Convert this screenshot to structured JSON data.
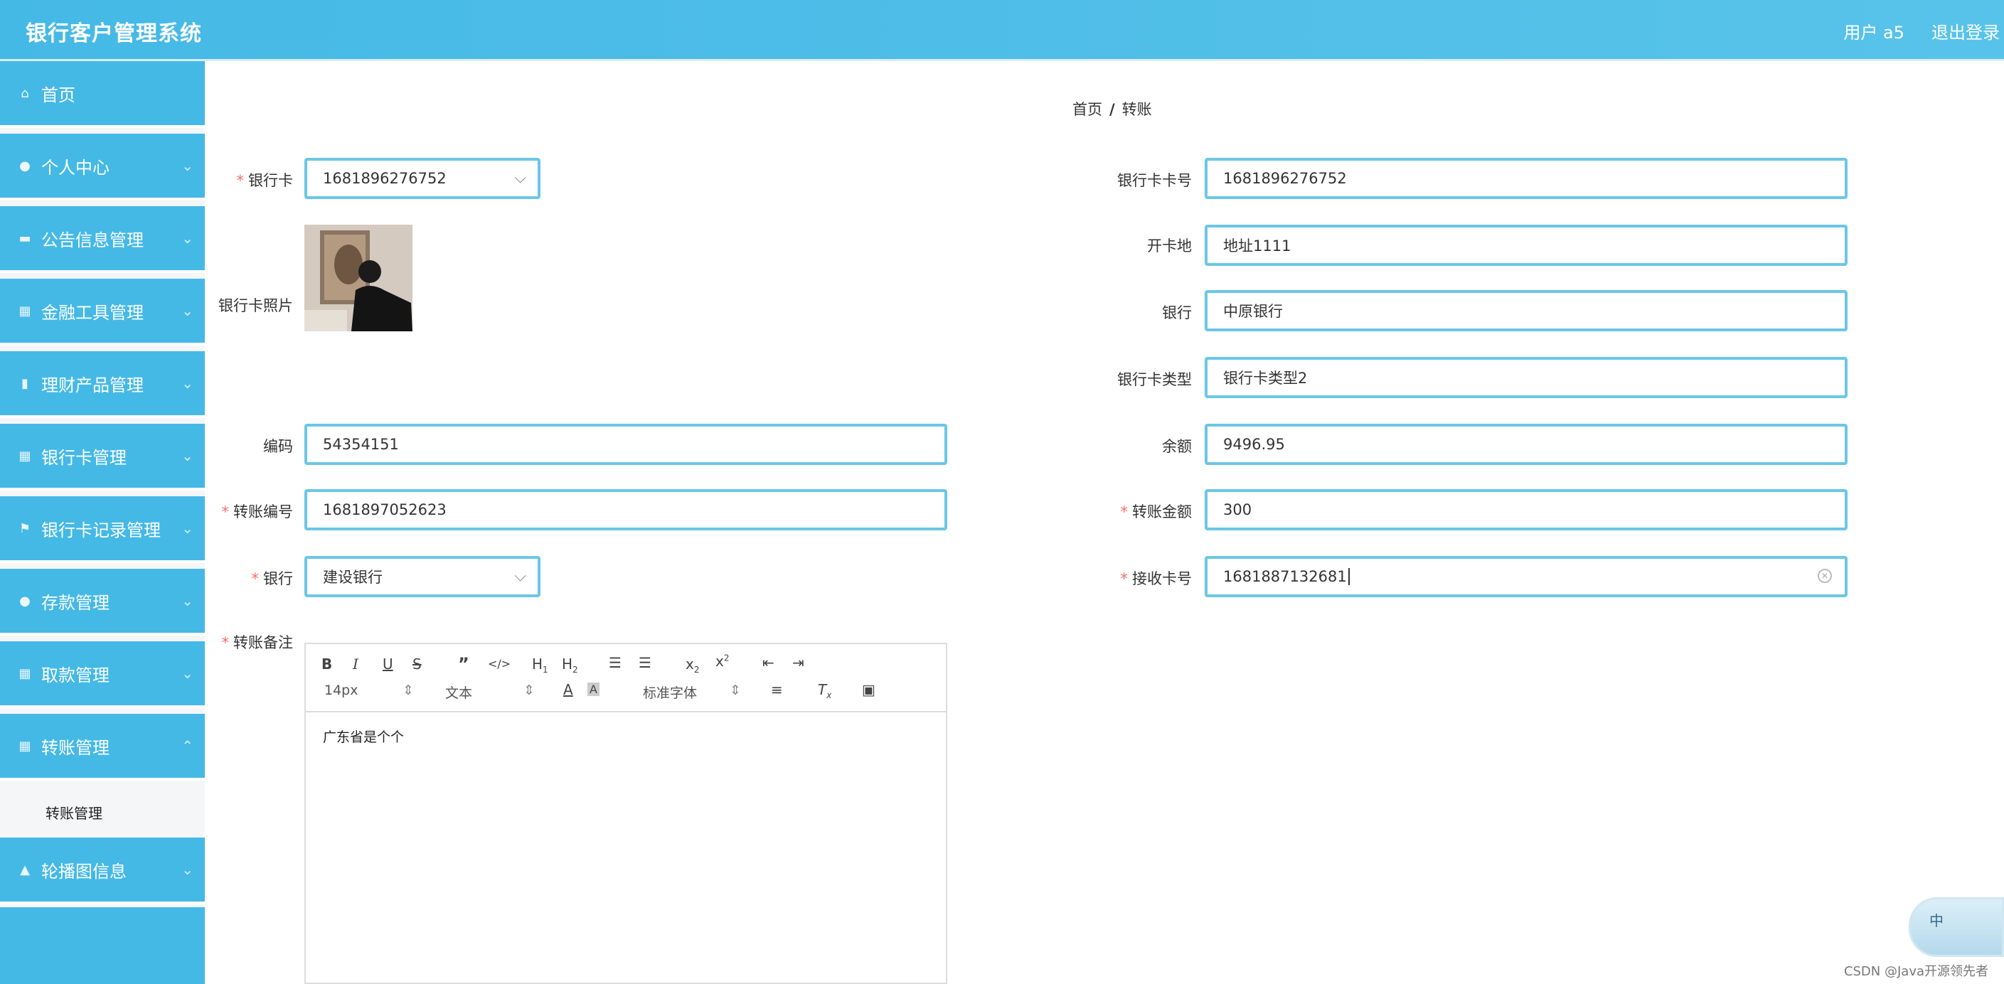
{
  "header": {
    "title": "银行客户管理系统",
    "user": "用户 a5",
    "logout": "退出登录"
  },
  "sidebar": {
    "items": [
      {
        "label": "首页",
        "icon": "home-icon"
      },
      {
        "label": "个人中心",
        "icon": "user-icon"
      },
      {
        "label": "公告信息管理",
        "icon": "notice-icon"
      },
      {
        "label": "金融工具管理",
        "icon": "grid-icon"
      },
      {
        "label": "理财产品管理",
        "icon": "bar-chart-icon"
      },
      {
        "label": "银行卡管理",
        "icon": "grid-icon"
      },
      {
        "label": "银行卡记录管理",
        "icon": "flag-icon"
      },
      {
        "label": "存款管理",
        "icon": "user-icon"
      },
      {
        "label": "取款管理",
        "icon": "grid-icon"
      },
      {
        "label": "转账管理",
        "icon": "grid-icon"
      },
      {
        "label": "轮播图信息",
        "icon": "image-icon"
      }
    ],
    "sub_item": "转账管理"
  },
  "breadcrumb": {
    "home": "首页",
    "separator": "/",
    "current": "转账"
  },
  "form": {
    "bank_card_label": "银行卡",
    "bank_card_value": "1681896276752",
    "photo_label": "银行卡照片",
    "code_label": "编码",
    "code_value": "54354151",
    "transfer_no_label": "转账编号",
    "transfer_no_value": "1681897052623",
    "bank_label": "银行",
    "bank_value": "建设银行",
    "remark_label": "转账备注",
    "card_no_label": "银行卡卡号",
    "card_no_value": "1681896276752",
    "open_place_label": "开卡地",
    "open_place_value": "地址1111",
    "bank2_label": "银行",
    "bank2_value": "中原银行",
    "card_type_label": "银行卡类型",
    "card_type_value": "银行卡类型2",
    "balance_label": "余额",
    "balance_value": "9496.95",
    "amount_label": "转账金额",
    "amount_value": "300",
    "receive_card_label": "接收卡号",
    "receive_card_value": "1681887132681"
  },
  "editor": {
    "font_size": "14px",
    "format": "文本",
    "font_family": "标准字体",
    "content": "广东省是个个"
  },
  "ime": {
    "label": "中"
  },
  "watermark": "CSDN @Java开源领先者",
  "colors": {
    "primary": "#45b9e6",
    "field_border": "#6cc6e6",
    "required": "#f56c6c"
  }
}
